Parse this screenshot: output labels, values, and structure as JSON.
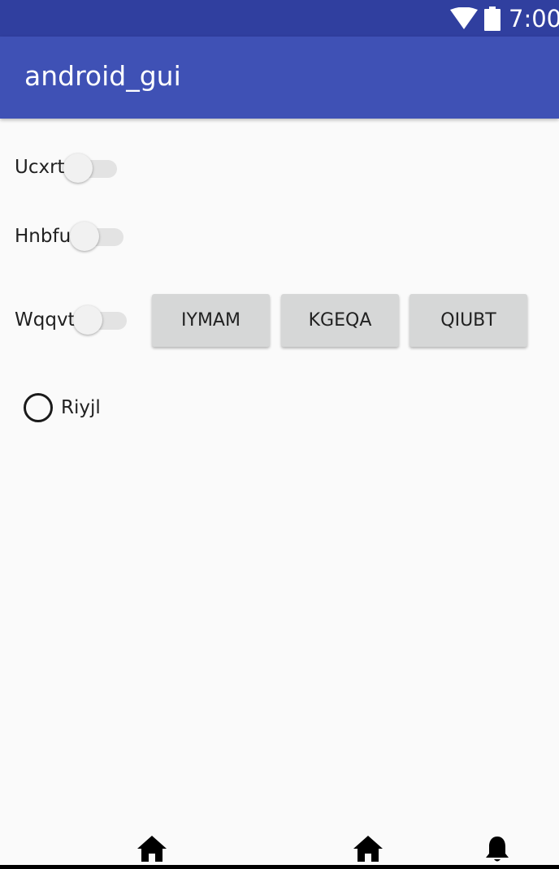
{
  "status_bar": {
    "time": "7:00",
    "icons": [
      "wifi-icon",
      "battery-icon"
    ]
  },
  "app_bar": {
    "title": "android_gui",
    "color": "#3f51b5",
    "status_color": "#303f9f"
  },
  "switches": [
    {
      "label": "Ucxrt",
      "checked": false
    },
    {
      "label": "Hnbfu",
      "checked": false
    },
    {
      "label": "Wqqvt",
      "checked": false
    }
  ],
  "buttons": [
    {
      "label": "IYMAM"
    },
    {
      "label": "KGEQA"
    },
    {
      "label": "QIUBT"
    }
  ],
  "radio": {
    "label": "Riyjl",
    "checked": false
  },
  "nav_bar": {
    "icons": [
      "home-icon",
      "home-icon",
      "bell-icon"
    ]
  }
}
